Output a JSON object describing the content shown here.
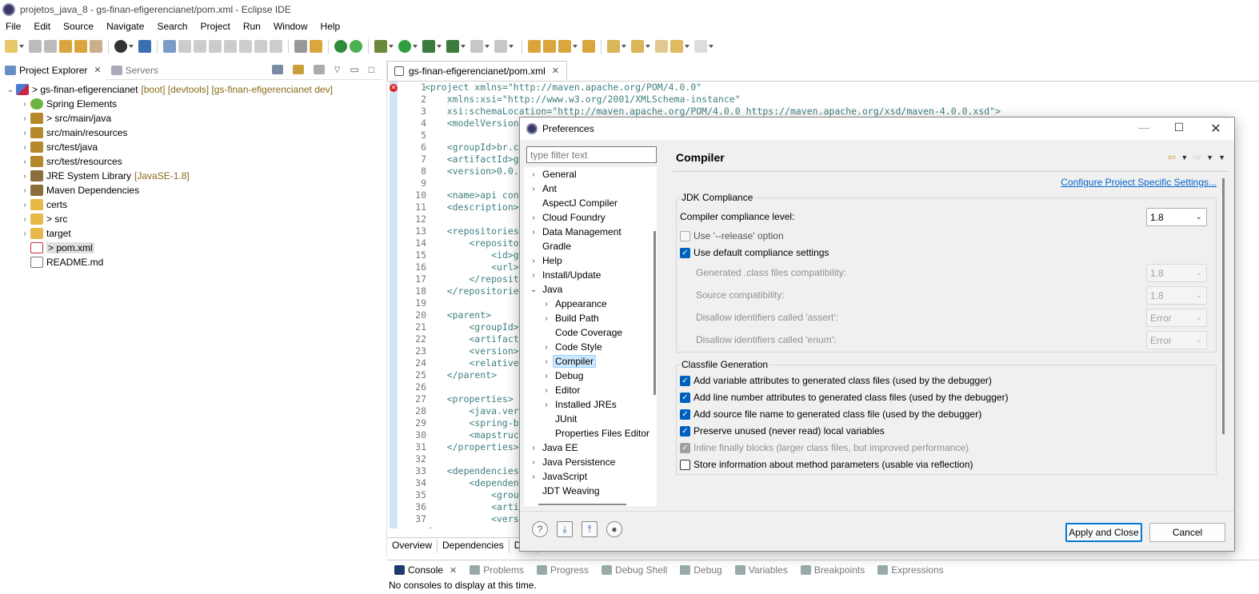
{
  "window": {
    "title": "projetos_java_8 - gs-finan-efigerencianet/pom.xml - Eclipse IDE"
  },
  "menubar": [
    "File",
    "Edit",
    "Source",
    "Navigate",
    "Search",
    "Project",
    "Run",
    "Window",
    "Help"
  ],
  "project_explorer": {
    "tabs": [
      {
        "label": "Project Explorer",
        "active": true
      },
      {
        "label": "Servers",
        "active": false
      }
    ],
    "tree": [
      {
        "label": "> gs-finan-efigerencianet",
        "decoration": "[boot] [devtools] [gs-finan-efigerencianet dev]",
        "icon": "project-icon",
        "expanded": true
      },
      {
        "label": "Spring Elements",
        "decoration": "",
        "icon": "spring-icon"
      },
      {
        "label": "> src/main/java",
        "decoration": "",
        "icon": "package-folder-icon"
      },
      {
        "label": "src/main/resources",
        "decoration": "",
        "icon": "package-folder-icon"
      },
      {
        "label": "src/test/java",
        "decoration": "",
        "icon": "package-folder-icon"
      },
      {
        "label": "src/test/resources",
        "decoration": "",
        "icon": "package-folder-icon"
      },
      {
        "label": "JRE System Library",
        "decoration": "[JavaSE-1.8]",
        "icon": "library-icon"
      },
      {
        "label": "Maven Dependencies",
        "decoration": "",
        "icon": "library-icon"
      },
      {
        "label": "certs",
        "decoration": "",
        "icon": "folder-icon"
      },
      {
        "label": "> src",
        "decoration": "",
        "icon": "folder-icon"
      },
      {
        "label": "target",
        "decoration": "",
        "icon": "folder-icon"
      },
      {
        "label": "> pom.xml",
        "decoration": "",
        "icon": "xml-file-icon"
      },
      {
        "label": "README.md",
        "decoration": "",
        "icon": "md-file-icon"
      }
    ]
  },
  "editor": {
    "tab": "gs-finan-efigerencianet/pom.xml",
    "line_numbers": [
      "1",
      "2",
      "3",
      "4",
      "5",
      "6",
      "7",
      "8",
      "9",
      "10",
      "11",
      "12",
      "13",
      "14",
      "15",
      "16",
      "17",
      "18",
      "19",
      "20",
      "21",
      "22",
      "23",
      "24",
      "25",
      "26",
      "27",
      "28",
      "29",
      "30",
      "31",
      "32",
      "33",
      "34",
      "35",
      "36",
      "37"
    ],
    "lines": [
      "<project xmlns=\"http://maven.apache.org/POM/4.0.0\"",
      "    xmlns:xsi=\"http://www.w3.org/2001/XMLSchema-instance\"",
      "    xsi:schemaLocation=\"http://maven.apache.org/POM/4.0.0 https://maven.apache.org/xsd/maven-4.0.0.xsd\">",
      "    <modelVersion",
      "",
      "    <groupId>br.c",
      "    <artifactId>g",
      "    <version>0.0.",
      "",
      "    <name>api con",
      "    <description>",
      "",
      "    <repositories",
      "        <reposito",
      "            <id>g",
      "            <url>",
      "        </reposit",
      "    </repositorie",
      "",
      "    <parent>",
      "        <groupId>",
      "        <artifact",
      "        <version>",
      "        <relative",
      "    </parent>",
      "",
      "    <properties>",
      "        <java.ver",
      "        <spring-b",
      "        <mapstruc",
      "    </properties>",
      "",
      "    <dependencies",
      "        <dependen",
      "            <grou",
      "            <arti",
      "            <vers"
    ],
    "bottom_tabs": [
      "Overview",
      "Dependencies",
      "Dep"
    ]
  },
  "console": {
    "tabs": [
      "Console",
      "Problems",
      "Progress",
      "Debug Shell",
      "Debug",
      "Variables",
      "Breakpoints",
      "Expressions"
    ],
    "message": "No consoles to display at this time."
  },
  "dialog": {
    "title": "Preferences",
    "filter_placeholder": "type filter text",
    "tree": [
      {
        "label": "General",
        "level": 0,
        "chev": "›"
      },
      {
        "label": "Ant",
        "level": 0,
        "chev": "›"
      },
      {
        "label": "AspectJ Compiler",
        "level": 0,
        "chev": ""
      },
      {
        "label": "Cloud Foundry",
        "level": 0,
        "chev": "›"
      },
      {
        "label": "Data Management",
        "level": 0,
        "chev": "›"
      },
      {
        "label": "Gradle",
        "level": 0,
        "chev": ""
      },
      {
        "label": "Help",
        "level": 0,
        "chev": "›"
      },
      {
        "label": "Install/Update",
        "level": 0,
        "chev": "›"
      },
      {
        "label": "Java",
        "level": 0,
        "chev": "⌄"
      },
      {
        "label": "Appearance",
        "level": 1,
        "chev": "›"
      },
      {
        "label": "Build Path",
        "level": 1,
        "chev": "›"
      },
      {
        "label": "Code Coverage",
        "level": 1,
        "chev": ""
      },
      {
        "label": "Code Style",
        "level": 1,
        "chev": "›"
      },
      {
        "label": "Compiler",
        "level": 1,
        "chev": "›",
        "selected": true
      },
      {
        "label": "Debug",
        "level": 1,
        "chev": "›"
      },
      {
        "label": "Editor",
        "level": 1,
        "chev": "›"
      },
      {
        "label": "Installed JREs",
        "level": 1,
        "chev": "›"
      },
      {
        "label": "JUnit",
        "level": 1,
        "chev": ""
      },
      {
        "label": "Properties Files Editor",
        "level": 1,
        "chev": ""
      },
      {
        "label": "Java EE",
        "level": 0,
        "chev": "›"
      },
      {
        "label": "Java Persistence",
        "level": 0,
        "chev": "›"
      },
      {
        "label": "JavaScript",
        "level": 0,
        "chev": "›"
      },
      {
        "label": "JDT Weaving",
        "level": 0,
        "chev": ""
      }
    ],
    "page": {
      "title": "Compiler",
      "link": "Configure Project Specific Settings...",
      "jdk_group": "JDK Compliance",
      "compliance_label": "Compiler compliance level:",
      "compliance_value": "1.8",
      "release_option": "Use '--release' option",
      "release_checked": false,
      "default_settings": "Use default compliance settings",
      "default_checked": true,
      "generated_label": "Generated .class files compatibility:",
      "generated_value": "1.8",
      "source_label": "Source compatibility:",
      "source_value": "1.8",
      "assert_label": "Disallow identifiers called 'assert':",
      "assert_value": "Error",
      "enum_label": "Disallow identifiers called 'enum':",
      "enum_value": "Error",
      "classfile_group": "Classfile Generation",
      "classfile_options": [
        {
          "label": "Add variable attributes to generated class files (used by the debugger)",
          "checked": true,
          "disabled": false
        },
        {
          "label": "Add line number attributes to generated class files (used by the debugger)",
          "checked": true,
          "disabled": false
        },
        {
          "label": "Add source file name to generated class file (used by the debugger)",
          "checked": true,
          "disabled": false
        },
        {
          "label": "Preserve unused (never read) local variables",
          "checked": true,
          "disabled": false
        },
        {
          "label": "Inline finally blocks (larger class files, but improved performance)",
          "checked": true,
          "disabled": true
        },
        {
          "label": "Store information about method parameters (usable via reflection)",
          "checked": false,
          "disabled": false
        }
      ]
    },
    "buttons": {
      "apply_close": "Apply and Close",
      "cancel": "Cancel"
    }
  }
}
